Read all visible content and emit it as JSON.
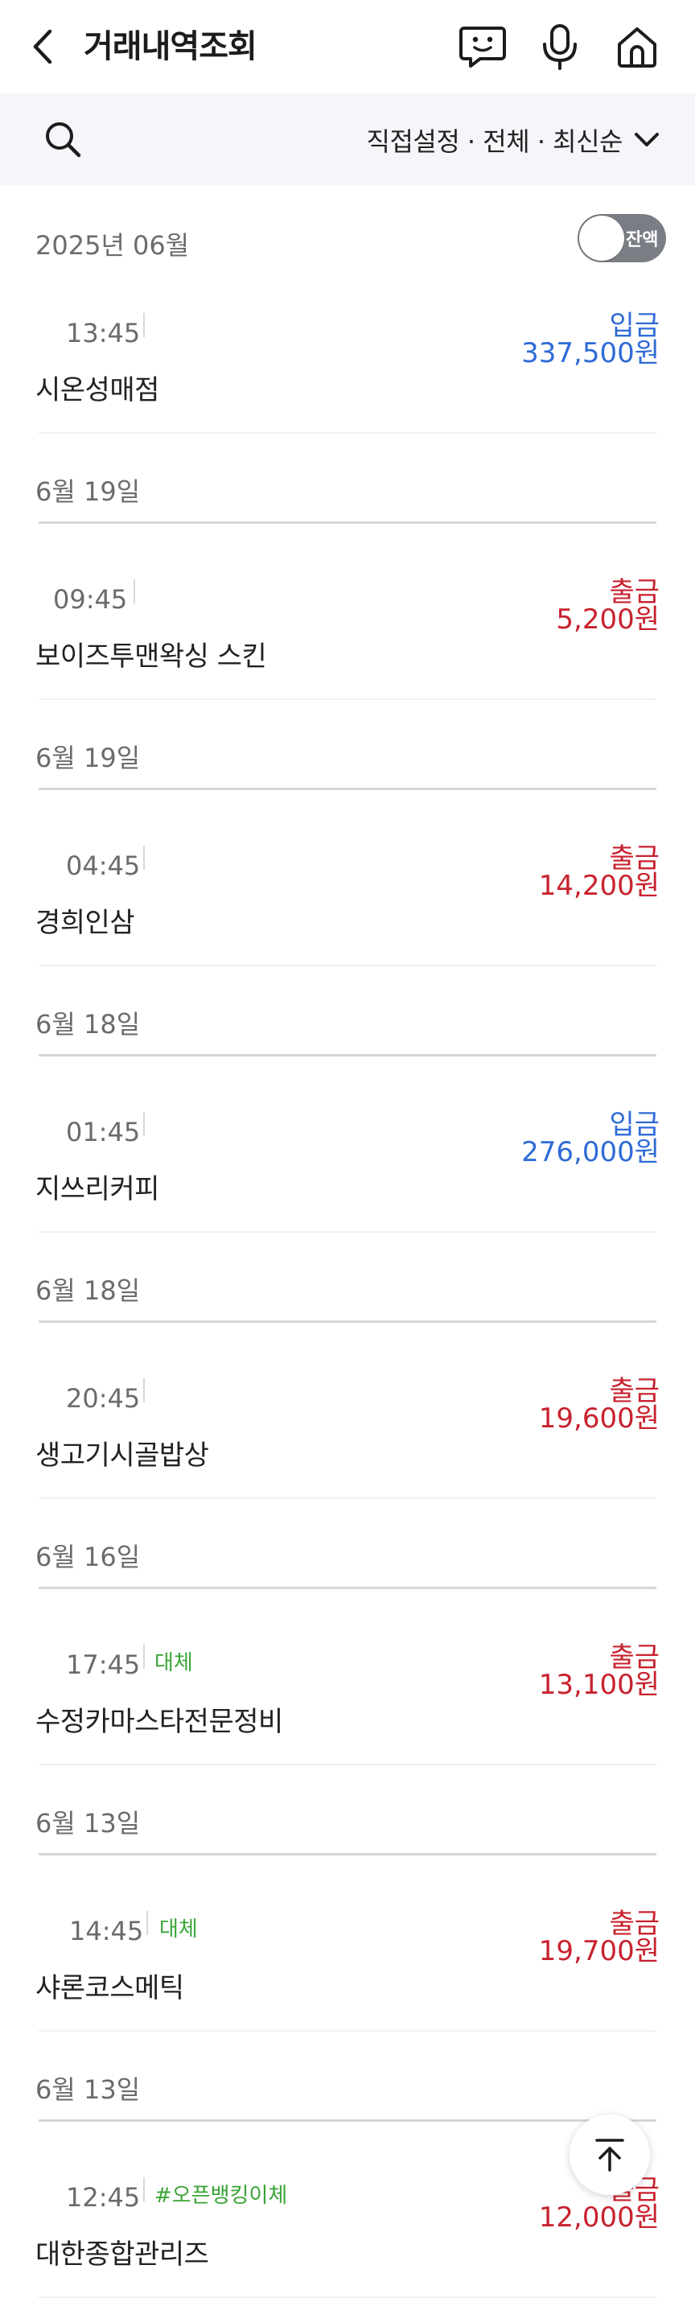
{
  "header": {
    "title": "거래내역조회",
    "icons": [
      "back-icon",
      "chatbot-icon",
      "microphone-icon",
      "home-icon"
    ]
  },
  "filter": {
    "label": "직접설정 · 전체 · 최신순",
    "icons": [
      "search-icon",
      "chevron-down-icon"
    ]
  },
  "month": "2025년 06월",
  "balance_toggle": {
    "label": "잔액",
    "on": false
  },
  "transactions": [
    {
      "date": "",
      "time": "13:45",
      "tag": "",
      "merchant": "시온성매점",
      "kind": "입금",
      "amount": "337,500원",
      "type": "deposit"
    },
    {
      "date": "6월 19일",
      "time": "09:45",
      "tag": "",
      "merchant": "보이즈투맨왁싱 스킨",
      "kind": "출금",
      "amount": "5,200원",
      "type": "withdraw"
    },
    {
      "date": "6월 19일",
      "time": "04:45",
      "tag": "",
      "merchant": "경희인삼",
      "kind": "출금",
      "amount": "14,200원",
      "type": "withdraw"
    },
    {
      "date": "6월 18일",
      "time": "01:45",
      "tag": "",
      "merchant": "지쓰리커피",
      "kind": "입금",
      "amount": "276,000원",
      "type": "deposit"
    },
    {
      "date": "6월 18일",
      "time": "20:45",
      "tag": "",
      "merchant": "생고기시골밥상",
      "kind": "출금",
      "amount": "19,600원",
      "type": "withdraw"
    },
    {
      "date": "6월 16일",
      "time": "17:45",
      "tag": "대체",
      "merchant": "수정카마스타전문정비",
      "kind": "출금",
      "amount": "13,100원",
      "type": "withdraw"
    },
    {
      "date": "6월 13일",
      "time": "14:45",
      "tag": "대체",
      "merchant": "샤론코스메틱",
      "kind": "출금",
      "amount": "19,700원",
      "type": "withdraw"
    },
    {
      "date": "6월 13일",
      "time": "12:45",
      "tag": "#오픈뱅킹이체",
      "merchant": "대한종합관리즈",
      "kind": "출금",
      "amount": "12,000원",
      "type": "withdraw"
    }
  ],
  "colors": {
    "deposit": "#2f6bd6",
    "withdraw": "#c8222e",
    "tag": "#3aa437",
    "filter_bg": "#f4f6fa"
  }
}
